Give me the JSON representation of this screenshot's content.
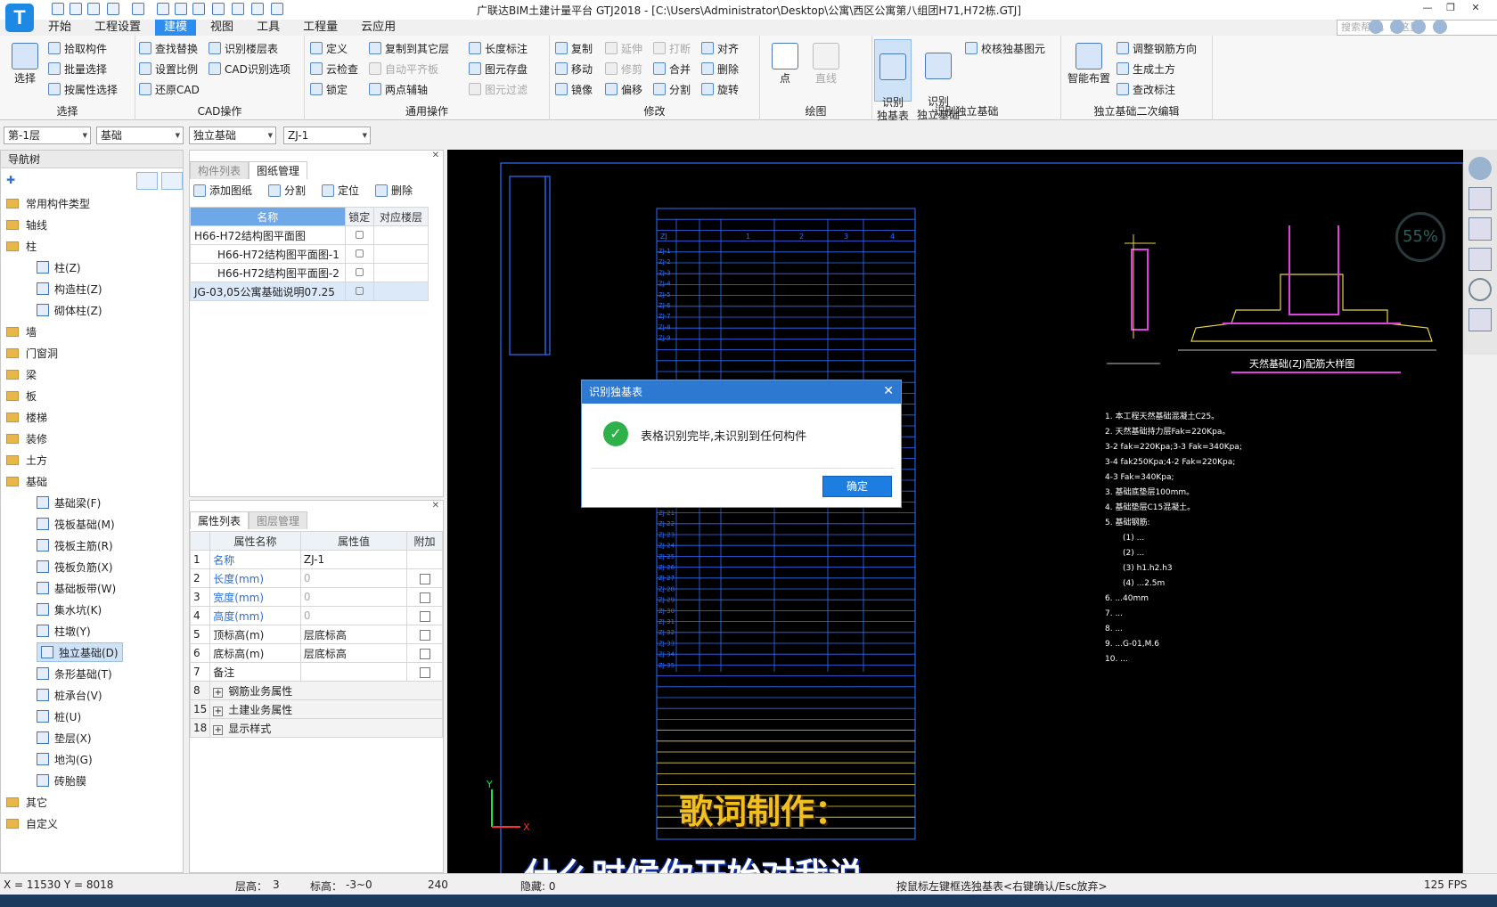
{
  "app": {
    "logo": "T",
    "window_title": "广联达BIM土建计量平台 GTJ2018 - [C:\\Users\\Administrator\\Desktop\\公寓\\西区公寓第八组团H71,H72栋.GTJ]",
    "search_placeholder": "搜索帮助，搜这里"
  },
  "menu": [
    "开始",
    "工程设置",
    "建模",
    "视图",
    "工具",
    "工程量",
    "云应用"
  ],
  "ribbon": {
    "select": {
      "big": "选择",
      "items": [
        "拾取构件",
        "批量选择",
        "按属性选择"
      ],
      "label": "选择"
    },
    "cad": {
      "items": [
        "查找替换",
        "识别楼层表",
        "设置比例",
        "CAD识别选项",
        "还原CAD"
      ],
      "label": "CAD操作"
    },
    "general": {
      "items": [
        "定义",
        "复制到其它层",
        "长度标注",
        "云检查",
        "自动平齐板",
        "图元存盘",
        "锁定",
        "两点辅轴",
        "图元过滤"
      ],
      "label": "通用操作"
    },
    "modify": {
      "items": [
        "复制",
        "延伸",
        "打断",
        "对齐",
        "移动",
        "修剪",
        "合并",
        "删除",
        "镜像",
        "偏移",
        "分割",
        "旋转"
      ],
      "label": "修改"
    },
    "draw": {
      "items": [
        "点",
        "直线"
      ],
      "label": "绘图"
    },
    "identify": {
      "big1": "识别\n独基表",
      "big2": "识别\n独立基础",
      "item": "校核独基图元",
      "label": "识别独立基础"
    },
    "edit2": {
      "big": "智能布置",
      "items": [
        "调整钢筋方向",
        "生成土方",
        "查改标注"
      ],
      "label": "独立基础二次编辑"
    }
  },
  "selectors": [
    "第-1层",
    "基础",
    "独立基础",
    "ZJ-1"
  ],
  "nav": {
    "title": "导航树",
    "items": [
      {
        "label": "常用构件类型",
        "type": "folder"
      },
      {
        "label": "轴线",
        "type": "folder"
      },
      {
        "label": "柱",
        "type": "folder"
      },
      {
        "label": "柱(Z)",
        "type": "leaf"
      },
      {
        "label": "构造柱(Z)",
        "type": "leaf"
      },
      {
        "label": "砌体柱(Z)",
        "type": "leaf"
      },
      {
        "label": "墙",
        "type": "folder"
      },
      {
        "label": "门窗洞",
        "type": "folder"
      },
      {
        "label": "梁",
        "type": "folder"
      },
      {
        "label": "板",
        "type": "folder"
      },
      {
        "label": "楼梯",
        "type": "folder"
      },
      {
        "label": "装修",
        "type": "folder"
      },
      {
        "label": "土方",
        "type": "folder"
      },
      {
        "label": "基础",
        "type": "folder"
      },
      {
        "label": "基础梁(F)",
        "type": "leaf"
      },
      {
        "label": "筏板基础(M)",
        "type": "leaf"
      },
      {
        "label": "筏板主筋(R)",
        "type": "leaf"
      },
      {
        "label": "筏板负筋(X)",
        "type": "leaf"
      },
      {
        "label": "基础板带(W)",
        "type": "leaf"
      },
      {
        "label": "集水坑(K)",
        "type": "leaf"
      },
      {
        "label": "柱墩(Y)",
        "type": "leaf"
      },
      {
        "label": "独立基础(D)",
        "type": "leaf",
        "selected": true
      },
      {
        "label": "条形基础(T)",
        "type": "leaf"
      },
      {
        "label": "桩承台(V)",
        "type": "leaf"
      },
      {
        "label": "桩(U)",
        "type": "leaf"
      },
      {
        "label": "垫层(X)",
        "type": "leaf"
      },
      {
        "label": "地沟(G)",
        "type": "leaf"
      },
      {
        "label": "砖胎膜",
        "type": "leaf"
      },
      {
        "label": "其它",
        "type": "folder"
      },
      {
        "label": "自定义",
        "type": "folder"
      }
    ]
  },
  "drawing_panel": {
    "tabs": [
      "构件列表",
      "图纸管理"
    ],
    "toolbar": [
      "添加图纸",
      "分割",
      "定位",
      "删除"
    ],
    "columns": [
      "名称",
      "锁定",
      "对应楼层"
    ],
    "rows": [
      {
        "name": "H66-H72结构图平面图",
        "indent": 0
      },
      {
        "name": "H66-H72结构图平面图-1",
        "indent": 1
      },
      {
        "name": "H66-H72结构图平面图-2",
        "indent": 1
      },
      {
        "name": "JG-03,05公寓基础说明07.25",
        "indent": 0,
        "selected": true
      }
    ]
  },
  "property_panel": {
    "tabs": [
      "属性列表",
      "图层管理"
    ],
    "columns": [
      "属性名称",
      "属性值",
      "附加"
    ],
    "rows": [
      {
        "no": "1",
        "name": "名称",
        "value": "ZJ-1",
        "blue": true,
        "check": false
      },
      {
        "no": "2",
        "name": "长度(mm)",
        "value": "0",
        "blue": true,
        "check": true
      },
      {
        "no": "3",
        "name": "宽度(mm)",
        "value": "0",
        "blue": true,
        "check": true
      },
      {
        "no": "4",
        "name": "高度(mm)",
        "value": "0",
        "blue": true,
        "check": true
      },
      {
        "no": "5",
        "name": "顶标高(m)",
        "value": "层底标高",
        "blue": false,
        "check": true
      },
      {
        "no": "6",
        "name": "底标高(m)",
        "value": "层底标高",
        "blue": false,
        "check": true
      },
      {
        "no": "7",
        "name": "备注",
        "value": "",
        "blue": false,
        "check": true
      },
      {
        "no": "8",
        "name": "钢筋业务属性",
        "value": "",
        "group": true
      },
      {
        "no": "15",
        "name": "土建业务属性",
        "value": "",
        "group": true
      },
      {
        "no": "18",
        "name": "显示样式",
        "value": "",
        "group": true
      }
    ]
  },
  "canvas": {
    "table_header": [
      "ZJ",
      "1",
      "2",
      "3",
      "4"
    ],
    "rows": [
      "ZJ-1",
      "ZJ-2",
      "ZJ-3",
      "ZJ-4",
      "ZJ-5",
      "ZJ-6",
      "ZJ-7",
      "ZJ-8",
      "ZJ-9"
    ],
    "rows_lower": [
      "ZJ-21",
      "ZJ-22",
      "ZJ-23",
      "ZJ-24",
      "ZJ-25",
      "ZJ-26",
      "ZJ-27",
      "ZJ-28",
      "ZJ-29",
      "ZJ-30",
      "ZJ-31",
      "ZJ-32",
      "ZJ-33",
      "ZJ-34",
      "ZJ-35"
    ],
    "detail_title": "天然基础(ZJ)配筋大样图",
    "notes": [
      "1. 本工程天然基础混凝土C25。",
      "2. 天然基础持力层Fak=220Kpa。",
      "3-2 fak=220Kpa;3-3 Fak=340Kpa;",
      "3-4 fak250Kpa;4-2 Fak=220Kpa;",
      "4-3 Fak=340Kpa;",
      "3. 基础底垫层100mm。",
      "4. 基础垫层C15混凝土。",
      "5. 基础钢筋:",
      "(1) ...",
      "(2) ...",
      "(3) h1.h2.h3",
      "(4) ...2.5m",
      "6. ...40mm",
      "7. ...",
      "8. ...",
      "9. ...G-01,M.6",
      "10. ..."
    ],
    "gauge": "55%",
    "subtitle1": "歌词制作：",
    "subtitle2": "什么时候你开始对我说"
  },
  "dialog": {
    "title": "识别独基表",
    "message": "表格识别完毕,未识别到任何构件",
    "ok": "确定"
  },
  "status": {
    "coords": "X = 11530 Y = 8018",
    "floor_label": "层高：",
    "floor_value": "3",
    "elev_label": "标高：",
    "elev_value": "-3~0",
    "num": "240",
    "hidden": "隐藏: 0",
    "hint": "按鼠标左键框选独基表<右键确认/Esc放弃>",
    "fps": "125 FPS"
  },
  "colors": {
    "accent": "#2d8cf0",
    "cad_blue": "#2e6fff",
    "cad_yellow": "#e8d24a",
    "subtitle": "#f0c020"
  }
}
